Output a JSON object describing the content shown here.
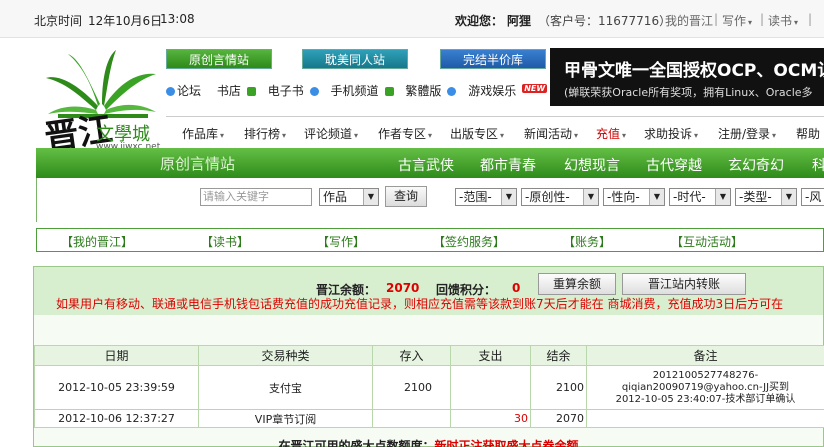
{
  "topbar": {
    "city_label": "北京时间",
    "date": "12年10月6日",
    "time": "13:08",
    "welcome": "欢迎您：",
    "username": "阿狸",
    "customer_no": "（客户号：11677716）",
    "links": [
      "我的晋江",
      "写作",
      "读书"
    ],
    "separator": "|"
  },
  "logo": {
    "name": "晋江",
    "sub": "文學城",
    "url": "www.jjwxc.net"
  },
  "site_buttons": [
    "原创言情站",
    "耽美同人站",
    "完结半价库"
  ],
  "small_nav": [
    "论坛",
    "书店",
    "电子书",
    "手机频道",
    "繁體版",
    "游戏娱乐"
  ],
  "new_badge": "NEW",
  "ad": {
    "line1": "甲骨文唯一全国授权OCP、OCM认",
    "line2": "(蝉联荣获Oracle所有奖项，拥有Linux、Oracle多"
  },
  "menu": [
    "作品库",
    "排行榜",
    "评论频道",
    "作者专区",
    "出版专区",
    "新闻活动",
    "充值",
    "求助投诉",
    "注册/登录",
    "帮助"
  ],
  "greenbar": {
    "site_name": "原创言情站",
    "categories": [
      "古言武侠",
      "都市青春",
      "幻想现言",
      "古代穿越",
      "玄幻奇幻",
      "科"
    ]
  },
  "search": {
    "placeholder": "请输入关键字",
    "type": "作品",
    "button": "查询",
    "filters": [
      "-范围-",
      "-原创性-",
      "-性向-",
      "-时代-",
      "-类型-",
      "-风"
    ]
  },
  "user_nav": [
    "【我的晋江】",
    "【读书】",
    "【写作】",
    "【签约服务】",
    "【账务】",
    "【互动活动】",
    "【"
  ],
  "balance": {
    "label": "晋江余额：",
    "value": "2070",
    "points_label": "回馈积分：",
    "points": "0",
    "recalc_button": "重算余额",
    "transfer_button": "晋江站内转账",
    "notice": "如果用户有移动、联通或电信手机钱包话费充值的成功充值记录，则相应充值需等该款到账7天后才能在 商城消费，充值成功3日后方可在"
  },
  "table": {
    "headers": [
      "日期",
      "交易种类",
      "存入",
      "支出",
      "结余",
      "备注"
    ],
    "rows": [
      {
        "date": "2012-10-05 23:39:59",
        "kind": "支付宝",
        "deposit": "2100",
        "expense": "",
        "balance": "2100",
        "note_line1": "2012100527748276-",
        "note_line2": "qiqian20090719@yahoo.cn-JJ买到",
        "note_line3": "2012-10-05 23:40:07-技术部订单确认"
      },
      {
        "date": "2012-10-06 12:37:27",
        "kind": "VIP章节订阅",
        "deposit": "",
        "expense": "30",
        "balance": "2070",
        "note_line1": "",
        "note_line2": "",
        "note_line3": ""
      }
    ]
  },
  "bottom": {
    "text1": "在晋江可用的盛大点数额度：",
    "text2": "新时正注获取盛大点券余额"
  },
  "colors": {
    "brand_green": "#2e8b1a",
    "alert_red": "#dd0000",
    "link_green": "#2d7a1c"
  }
}
